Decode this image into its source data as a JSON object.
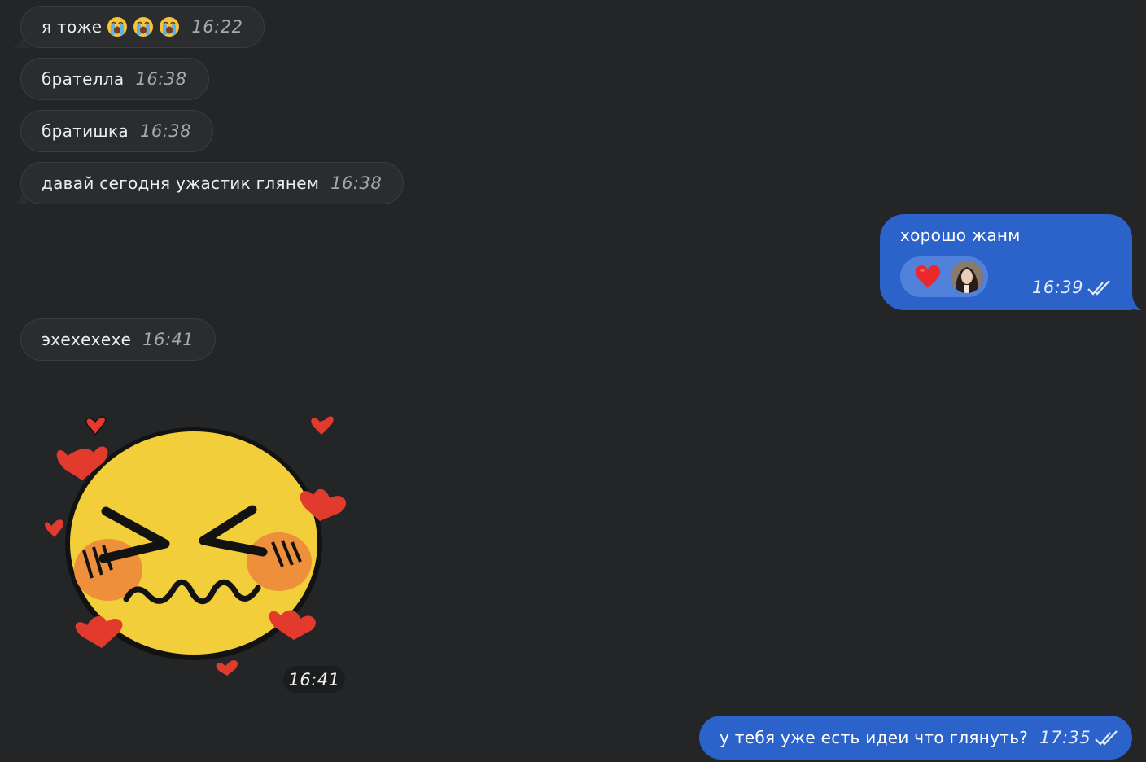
{
  "messages": {
    "m1": {
      "text": "я тоже",
      "emojis": [
        "crying-face",
        "crying-face",
        "crying-face"
      ],
      "time": "16:22"
    },
    "m2": {
      "text": "брателла",
      "time": "16:38"
    },
    "m3": {
      "text": "братишка",
      "time": "16:38"
    },
    "m4": {
      "text": "давай сегодня ужастик глянем",
      "time": "16:38"
    },
    "m5": {
      "text": "хорошо жанм",
      "time": "16:39",
      "reaction": "heart",
      "status": "read"
    },
    "m6": {
      "text": "эхехехехе",
      "time": "16:41"
    },
    "m7": {
      "type": "sticker",
      "sticker": "blushing-cursed-emoji-with-hearts",
      "time": "16:41"
    },
    "m8": {
      "text": "у тебя уже есть идеи что глянуть?",
      "time": "17:35",
      "status": "read"
    }
  },
  "colors": {
    "background": "#232527",
    "incoming_bubble": "#2a2c2e",
    "outgoing_bubble": "#2b63cb",
    "reaction_heart": "#e8282b"
  }
}
